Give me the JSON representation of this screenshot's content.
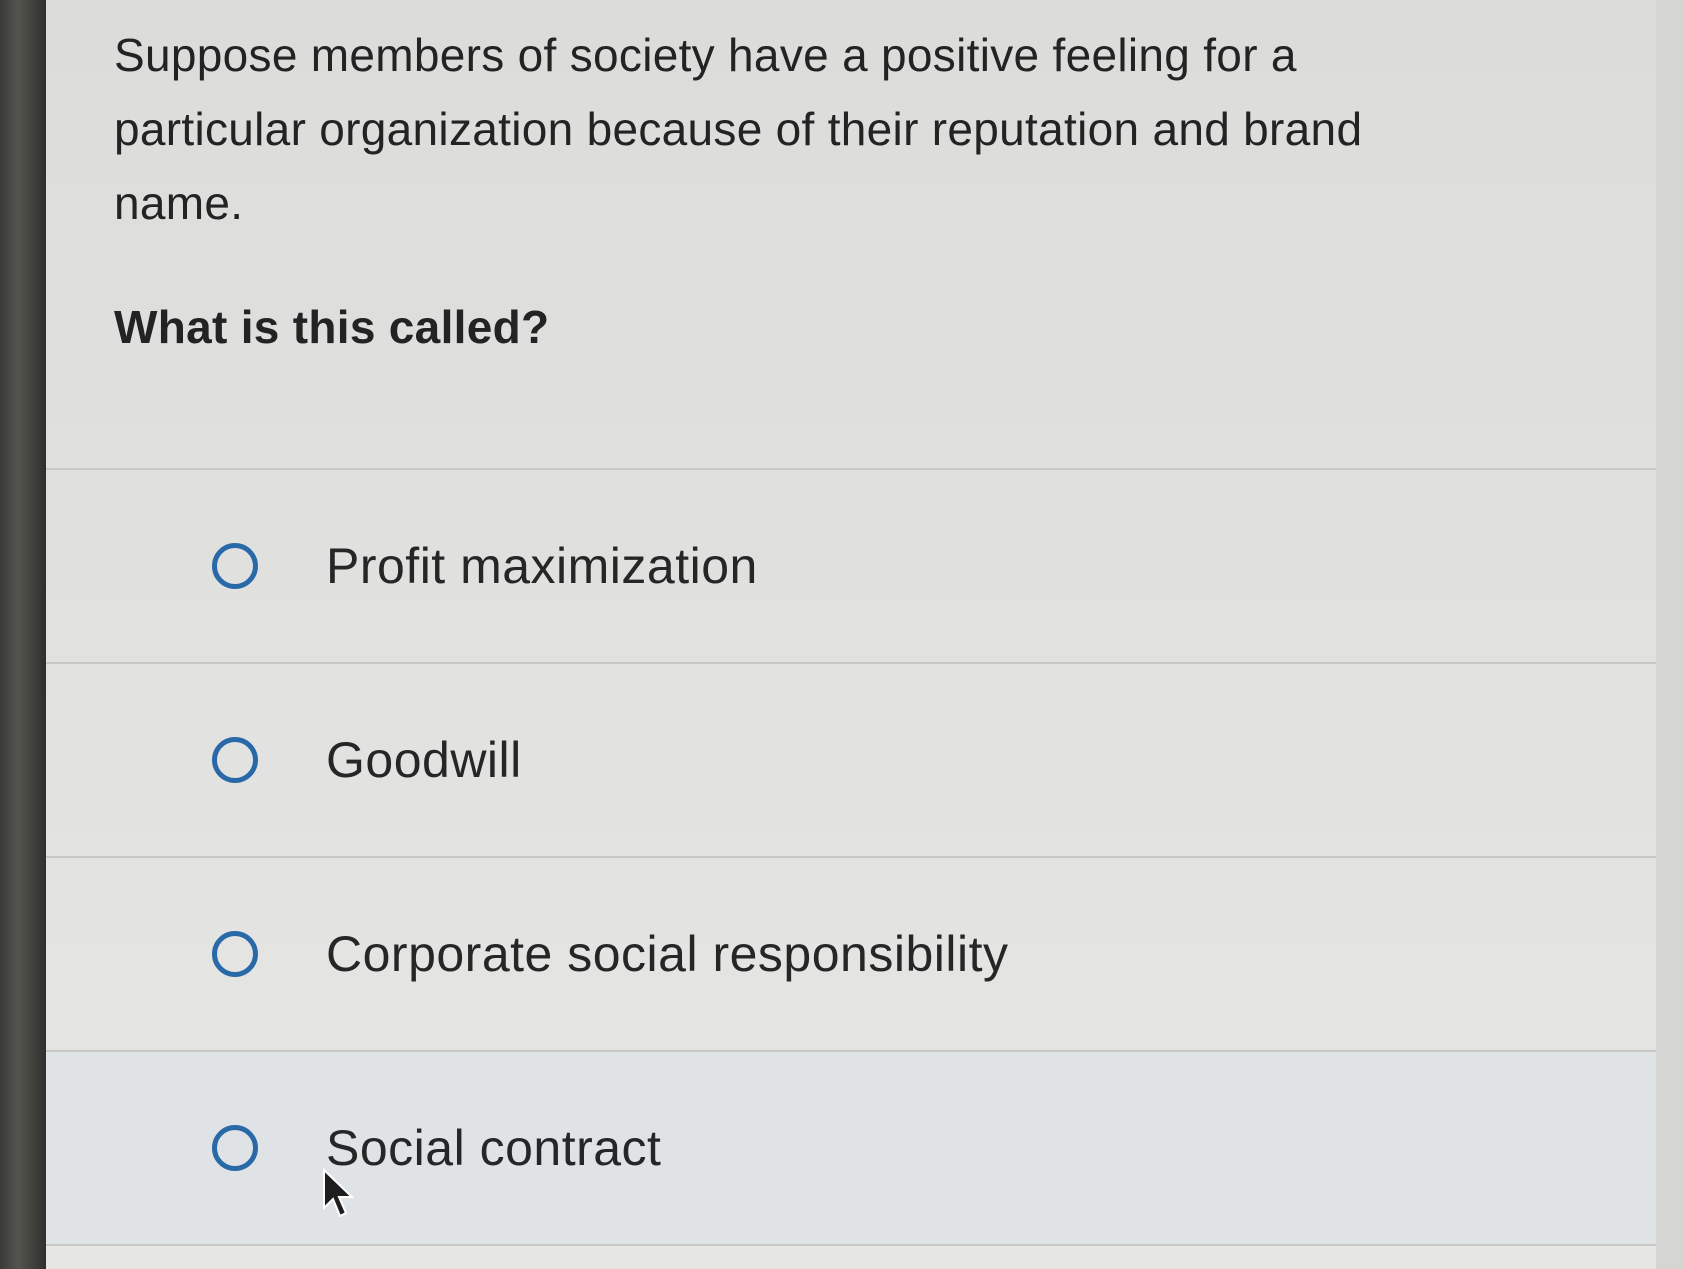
{
  "question": {
    "lines": [
      "Suppose members of society have a positive feeling for a",
      "particular organization because of their reputation and brand",
      "name."
    ],
    "prompt": "What is this called?"
  },
  "options": [
    {
      "label": "Profit maximization"
    },
    {
      "label": "Goodwill"
    },
    {
      "label": "Corporate social responsibility"
    },
    {
      "label": "Social contract"
    }
  ],
  "colors": {
    "radio": "#2a69a8",
    "text": "#232323"
  },
  "icons": {
    "cursor": "mouse-pointer-icon",
    "radio": "radio-button-icon"
  }
}
